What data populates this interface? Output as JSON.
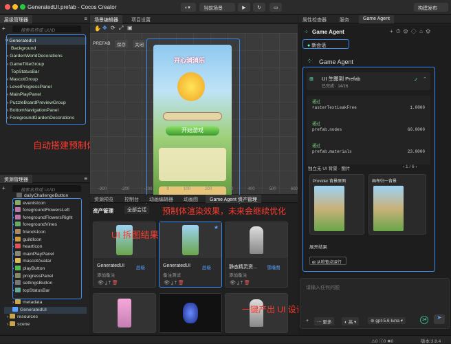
{
  "window": {
    "title": "GeneratedUI.prefab - Cocos Creator",
    "scene_selector": "当前场景",
    "build_publish": "构建发布"
  },
  "hierarchy": {
    "tab": "层级管理器",
    "search_placeholder": "搜索名称或 UUID",
    "items": [
      "GeneratedUI",
      "Background",
      "GardenWorldDecorations",
      "GameTitleGroup",
      "TopStatusBar",
      "MascotGroup",
      "LevelProgressPanel",
      "MainPlayPanel",
      "PuzzleBoardPreviewGroup",
      "BottomNavigationPanel",
      "ForegroundGardenDecorations"
    ]
  },
  "assets": {
    "tab": "资源管理器",
    "search_placeholder": "搜索名称或 UUID",
    "items": [
      "dailyChallengeButton",
      "eventsIcon",
      "foregroundFlowersLeft",
      "foregroundFlowersRight",
      "foregroundVines",
      "friendsIcon",
      "guildIcon",
      "heartIcon",
      "mainPlayPanel",
      "mascotAvatar",
      "playButton",
      "progressPanel",
      "settingsButton",
      "topStatusBar",
      "metadata",
      "GeneratedUI",
      "resources",
      "scene"
    ]
  },
  "scene": {
    "tabs": [
      "场景编辑器",
      "项目设置"
    ],
    "prefab_label": "PREFAB",
    "save": "保存",
    "close": "关闭",
    "ruler_labels": [
      "-300",
      "-200",
      "-100",
      "0",
      "100",
      "200",
      "300",
      "400",
      "500",
      "600"
    ],
    "game_title": "开心消消乐",
    "start_button": "开始游戏"
  },
  "bottom_tabs": [
    "资源预览",
    "控制台",
    "动画编辑器",
    "动画图",
    "Game Agent 资产管理"
  ],
  "asset_manager": {
    "title": "资产管理",
    "filter": "全部会话",
    "cards": [
      {
        "name": "GeneratedUI",
        "badge": "层级",
        "sub": "添加备注"
      },
      {
        "name": "GeneratedUI",
        "badge": "层级",
        "sub": "备注测试"
      },
      {
        "name": "静态精灵资...",
        "badge": "雪橇图",
        "sub": "添加备注"
      }
    ]
  },
  "right_tabs": [
    "属性检查器",
    "服务",
    "Game Agent"
  ],
  "agent": {
    "header": "Game Agent",
    "new_session": "新会话",
    "bot_name": "Game Agent",
    "task_title": "UI 生图到 Prefab",
    "task_status": "已完成 · 14/16",
    "checks": [
      {
        "label": "通过",
        "key": "rasterTextLeakFree",
        "value": "1.0000"
      },
      {
        "label": "通过",
        "key": "prefab.nodes",
        "value": "60.0000"
      },
      {
        "label": "通过",
        "key": "prefab.materials",
        "value": "23.0000"
      }
    ],
    "independent": "独立无 UI 背景 · 图片",
    "pager": "1 / 6",
    "preview_left": "Provider 背景原图",
    "preview_right": "画布归一背景",
    "expand": "展开结果",
    "rerun": "从检查点运行",
    "input_placeholder": "请输入任何问题",
    "more": "更多",
    "quality": "高",
    "model": "gpt-5.6-luna",
    "version": "版本:3.8.4",
    "counter": "14"
  },
  "annotations": {
    "a1": "自动搭建预制体",
    "a2": "UI 拆图结果",
    "a3": "预制体渲染效果，未来会继续优化",
    "a4": "一键产出 UI 设计图、拆图、搭建 UI 预制体"
  },
  "colors": {
    "accent": "#3d8df5",
    "annotation": "#ff3b2f",
    "green_text": "#c8e6c8"
  }
}
